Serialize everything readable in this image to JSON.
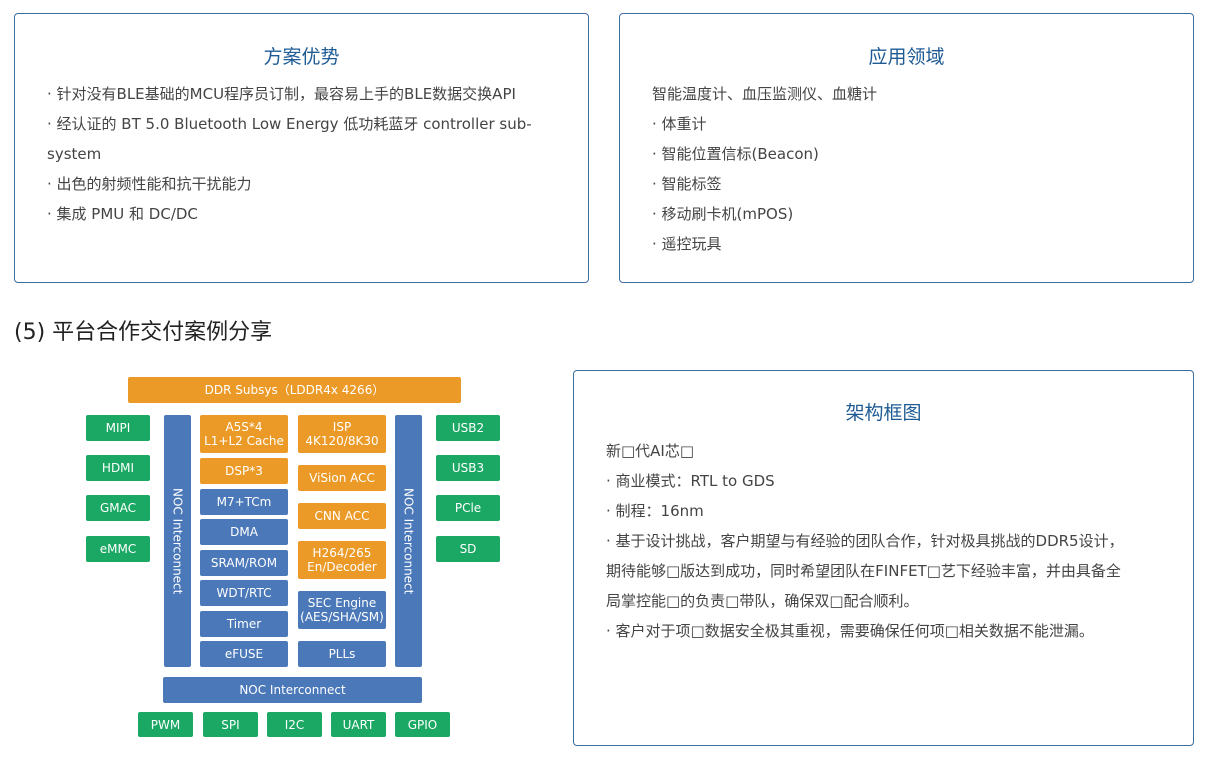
{
  "advantages": {
    "title": "方案优势",
    "lines": [
      "· 针对没有BLE基础的MCU程序员订制，最容易上手的BLE数据交换API",
      "· 经认证的 BT 5.0 Bluetooth Low Energy 低功耗蓝牙 controller sub-",
      "system",
      "· 出色的射频性能和抗干扰能力",
      "· 集成 PMU 和 DC/DC"
    ]
  },
  "applications": {
    "title": "应用领域",
    "lines": [
      "智能温度计、血压监测仪、血糖计",
      "· 体重计",
      "· 智能位置信标(Beacon)",
      "· 智能标签",
      "· 移动刷卡机(mPOS)",
      "· 遥控玩具"
    ]
  },
  "section_heading": "(5) 平台合作交付案例分享",
  "architecture": {
    "title": "架构框图",
    "lines": [
      "新□代AI芯□",
      "· 商业模式：RTL to GDS",
      "· 制程：16nm",
      "· 基于设计挑战，客户期望与有经验的团队合作，针对极具挑战的DDR5设计，",
      "期待能够□版达到成功，同时希望团队在FINFET□艺下经验丰富，并由具备全",
      "局掌控能□的负责□带队，确保双□配合顺利。",
      "· 客户对于项□数据安全极其重视，需要确保任何项□相关数据不能泄漏。"
    ]
  },
  "diagram": {
    "colors": {
      "orange": "#ec9a27",
      "blue": "#4a78b8",
      "green": "#1aa864"
    },
    "ddr": "DDR Subsys（LDDR4x 4266）",
    "left_io": [
      "MIPI",
      "HDMI",
      "GMAC",
      "eMMC"
    ],
    "right_io": [
      "USB2",
      "USB3",
      "PCle",
      "SD"
    ],
    "noc_vertical": "NOC Interconnect",
    "noc_bottom": "NOC Interconnect",
    "col1_orange": [
      "A5S*4\nL1+L2 Cache",
      "DSP*3"
    ],
    "col1_blue": [
      "M7+TCm",
      "DMA",
      "SRAM/ROM",
      "WDT/RTC",
      "Timer",
      "eFUSE"
    ],
    "col2_orange": [
      "ISP\n4K120/8K30",
      "ViSion ACC",
      "CNN ACC",
      "H264/265\nEn/Decoder"
    ],
    "col2_blue": [
      "SEC Engine\n(AES/SHA/SM)",
      "PLLs"
    ],
    "bottom_io": [
      "PWM",
      "SPI",
      "I2C",
      "UART",
      "GPIO"
    ]
  }
}
